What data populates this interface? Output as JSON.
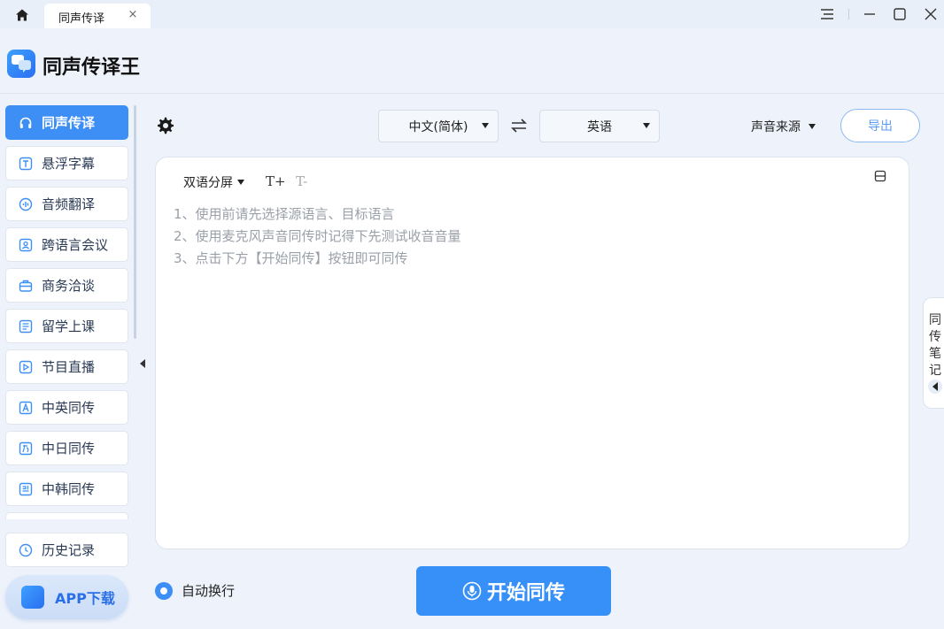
{
  "titlebar": {
    "tab_label": "同声传译",
    "tab_close": "×"
  },
  "header": {
    "app_title": "同声传译王",
    "logo_icon": "chat-bubble-logo-icon"
  },
  "sidebar": {
    "items": [
      {
        "label": "同声传译",
        "icon": "headphones-icon",
        "active": true
      },
      {
        "label": "悬浮字幕",
        "icon": "text-box-icon"
      },
      {
        "label": "音频翻译",
        "icon": "audio-wave-icon"
      },
      {
        "label": "跨语言会议",
        "icon": "person-card-icon"
      },
      {
        "label": "商务洽谈",
        "icon": "briefcase-icon"
      },
      {
        "label": "留学上课",
        "icon": "book-icon"
      },
      {
        "label": "节目直播",
        "icon": "play-icon"
      },
      {
        "label": "中英同传",
        "icon": "letter-a-icon"
      },
      {
        "label": "中日同传",
        "icon": "kana-icon"
      },
      {
        "label": "中韩同传",
        "icon": "hangul-icon"
      }
    ],
    "history_label": "历史记录",
    "app_download_label": "APP下载"
  },
  "toolbar": {
    "source_language": "中文(简体)",
    "target_language": "英语",
    "voice_source_label": "声音来源",
    "export_label": "导出"
  },
  "panel": {
    "display_mode": "双语分屏",
    "font_increase": "T+",
    "font_decrease": "T-",
    "hints": [
      "1、使用前请先选择源语言、目标语言",
      "2、使用麦克风声音同传时记得下先测试收音音量",
      "3、点击下方【开始同传】按钮即可同传"
    ]
  },
  "footer": {
    "auto_wrap_label": "自动换行",
    "auto_wrap_checked": true,
    "start_label": "开始同传"
  },
  "notes_tab": {
    "label": "同传笔记"
  },
  "colors": {
    "accent": "#3d8ff5",
    "background": "#eef3fb",
    "hint_text": "#9aa0a8"
  }
}
